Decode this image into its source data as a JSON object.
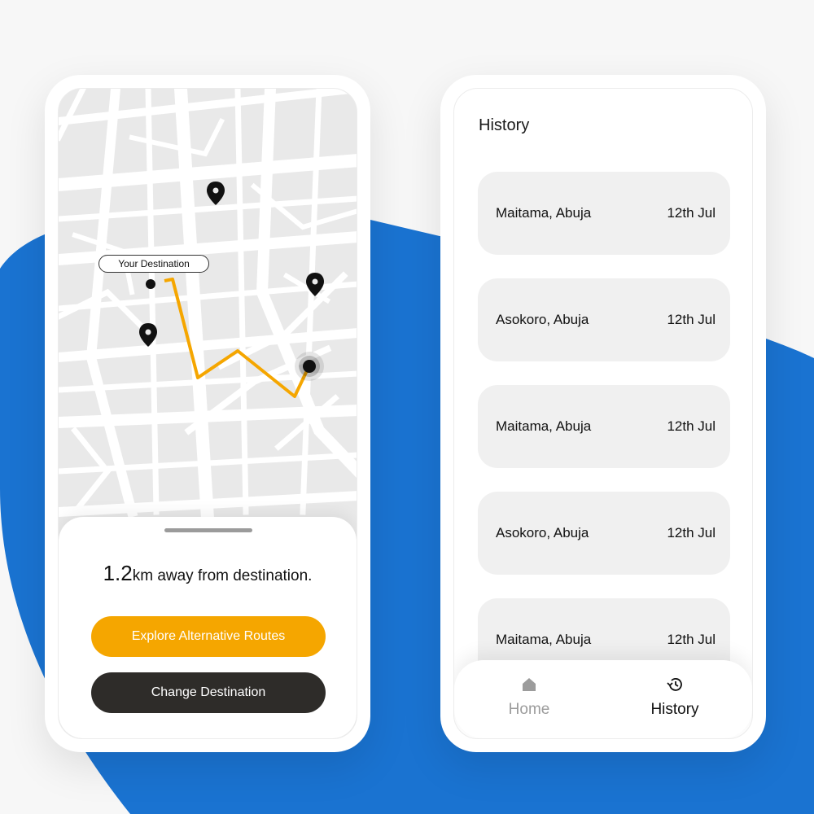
{
  "colors": {
    "accent_orange": "#f5a600",
    "dark_button": "#2e2c29",
    "background_blue": "#1a73d1",
    "map_base": "#e9e9e9",
    "card_grey": "#f0f0f0"
  },
  "map": {
    "destination_label": "Your Destination",
    "icons": [
      "location-pin-icon",
      "location-pin-icon",
      "location-pin-icon",
      "current-location-icon"
    ]
  },
  "sheet": {
    "distance_value": "1.2",
    "distance_text": "km away from destination.",
    "explore_button": "Explore Alternative Routes",
    "change_button": "Change Destination"
  },
  "history": {
    "title": "History",
    "items": [
      {
        "place": "Maitama, Abuja",
        "date": "12th Jul"
      },
      {
        "place": "Asokoro, Abuja",
        "date": "12th Jul"
      },
      {
        "place": "Maitama, Abuja",
        "date": "12th Jul"
      },
      {
        "place": "Asokoro, Abuja",
        "date": "12th Jul"
      },
      {
        "place": "Maitama, Abuja",
        "date": "12th Jul"
      }
    ]
  },
  "tabbar": {
    "home_label": "Home",
    "home_icon": "home-icon",
    "history_label": "History",
    "history_icon": "history-icon",
    "active": "History"
  }
}
